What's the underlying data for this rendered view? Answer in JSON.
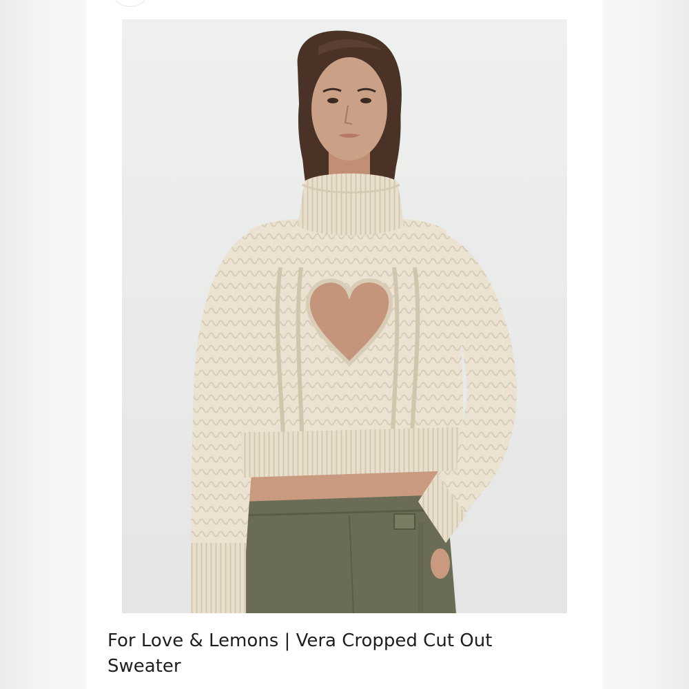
{
  "listing": {
    "title": "For Love & Lemons | Vera Cropped Cut Out Sweater",
    "image_alt": "Model wearing a cream cable-knit cropped turtleneck sweater with a heart-shaped cut out and olive cargo pants"
  },
  "colors": {
    "sweater": "#ece3d2",
    "pants": "#6b6c55",
    "background": "#ecedec",
    "hair": "#4a3326",
    "skin": "#c99a7f"
  }
}
